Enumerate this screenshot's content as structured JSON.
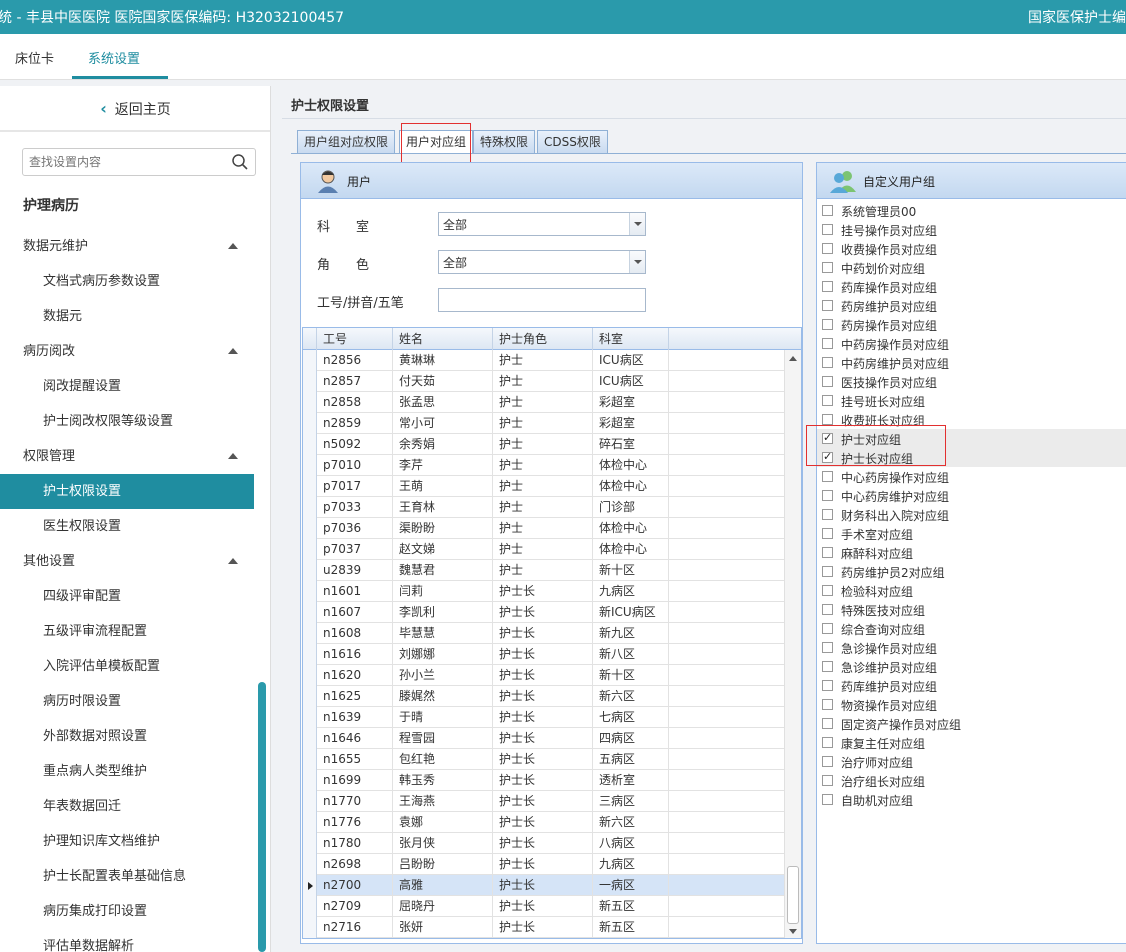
{
  "header": {
    "title": "统 - 丰县中医医院    医院国家医保编码: H32032100457",
    "right_text": "国家医保护士编码"
  },
  "topnav": {
    "tabs": [
      "床位卡",
      "系统设置"
    ]
  },
  "sidebar": {
    "back_label": "返回主页",
    "search_placeholder": "查找设置内容",
    "section_title": "护理病历",
    "items": [
      {
        "label": "数据元维护",
        "level": 1,
        "expand": true
      },
      {
        "label": "文档式病历参数设置",
        "level": 2
      },
      {
        "label": "数据元",
        "level": 2
      },
      {
        "label": "病历阅改",
        "level": 1,
        "expand": true
      },
      {
        "label": "阅改提醒设置",
        "level": 2
      },
      {
        "label": "护士阅改权限等级设置",
        "level": 2
      },
      {
        "label": "权限管理",
        "level": 1,
        "expand": true
      },
      {
        "label": "护士权限设置",
        "level": 2,
        "active": true
      },
      {
        "label": "医生权限设置",
        "level": 2
      },
      {
        "label": "其他设置",
        "level": 1,
        "expand": true
      },
      {
        "label": "四级评审配置",
        "level": 2
      },
      {
        "label": "五级评审流程配置",
        "level": 2
      },
      {
        "label": "入院评估单模板配置",
        "level": 2
      },
      {
        "label": "病历时限设置",
        "level": 2
      },
      {
        "label": "外部数据对照设置",
        "level": 2
      },
      {
        "label": "重点病人类型维护",
        "level": 2
      },
      {
        "label": "年表数据回迁",
        "level": 2
      },
      {
        "label": "护理知识库文档维护",
        "level": 2
      },
      {
        "label": "护士长配置表单基础信息",
        "level": 2
      },
      {
        "label": "病历集成打印设置",
        "level": 2
      },
      {
        "label": "评估单数据解析",
        "level": 2
      }
    ]
  },
  "main": {
    "title": "护士权限设置",
    "tabs": [
      "用户组对应权限",
      "用户对应组",
      "特殊权限",
      "CDSS权限"
    ],
    "active_tab": 1
  },
  "user_panel": {
    "title": "用户",
    "dept_label": "科　　室",
    "dept_value": "全部",
    "role_label": "角　　色",
    "role_value": "全部",
    "search_label": "工号/拼音/五笔",
    "search_value": ""
  },
  "grid": {
    "columns": [
      "工号",
      "姓名",
      "护士角色",
      "科室"
    ],
    "rows": [
      [
        "n2856",
        "黄琳琳",
        "护士",
        "ICU病区"
      ],
      [
        "n2857",
        "付天茹",
        "护士",
        "ICU病区"
      ],
      [
        "n2858",
        "张孟思",
        "护士",
        "彩超室"
      ],
      [
        "n2859",
        "常小可",
        "护士",
        "彩超室"
      ],
      [
        "n5092",
        "余秀娟",
        "护士",
        "碎石室"
      ],
      [
        "p7010",
        "李芹",
        "护士",
        "体检中心"
      ],
      [
        "p7017",
        "王萌",
        "护士",
        "体检中心"
      ],
      [
        "p7033",
        "王育林",
        "护士",
        "门诊部"
      ],
      [
        "p7036",
        "渠盼盼",
        "护士",
        "体检中心"
      ],
      [
        "p7037",
        "赵文娣",
        "护士",
        "体检中心"
      ],
      [
        "u2839",
        "魏慧君",
        "护士",
        "新十区"
      ],
      [
        "n1601",
        "闫莉",
        "护士长",
        "九病区"
      ],
      [
        "n1607",
        "李凯利",
        "护士长",
        "新ICU病区"
      ],
      [
        "n1608",
        "毕慧慧",
        "护士长",
        "新九区"
      ],
      [
        "n1616",
        "刘娜娜",
        "护士长",
        "新八区"
      ],
      [
        "n1620",
        "孙小兰",
        "护士长",
        "新十区"
      ],
      [
        "n1625",
        "滕娓然",
        "护士长",
        "新六区"
      ],
      [
        "n1639",
        "于晴",
        "护士长",
        "七病区"
      ],
      [
        "n1646",
        "程雪园",
        "护士长",
        "四病区"
      ],
      [
        "n1655",
        "包红艳",
        "护士长",
        "五病区"
      ],
      [
        "n1699",
        "韩玉秀",
        "护士长",
        "透析室"
      ],
      [
        "n1770",
        "王海燕",
        "护士长",
        "三病区"
      ],
      [
        "n1776",
        "袁娜",
        "护士长",
        "新六区"
      ],
      [
        "n1780",
        "张月侠",
        "护士长",
        "八病区"
      ],
      [
        "n2698",
        "吕盼盼",
        "护士长",
        "九病区"
      ],
      [
        "n2700",
        "高雅",
        "护士长",
        "一病区"
      ],
      [
        "n2709",
        "屈晓丹",
        "护士长",
        "新五区"
      ],
      [
        "n2716",
        "张妍",
        "护士长",
        "新五区"
      ]
    ],
    "selected_row": 25
  },
  "group_panel": {
    "title": "自定义用户组",
    "items": [
      {
        "label": "系统管理员00",
        "checked": false
      },
      {
        "label": "挂号操作员对应组",
        "checked": false
      },
      {
        "label": "收费操作员对应组",
        "checked": false
      },
      {
        "label": "中药划价对应组",
        "checked": false
      },
      {
        "label": "药库操作员对应组",
        "checked": false
      },
      {
        "label": "药房维护员对应组",
        "checked": false
      },
      {
        "label": "药房操作员对应组",
        "checked": false
      },
      {
        "label": "中药房操作员对应组",
        "checked": false
      },
      {
        "label": "中药房维护员对应组",
        "checked": false
      },
      {
        "label": "医技操作员对应组",
        "checked": false
      },
      {
        "label": "挂号班长对应组",
        "checked": false
      },
      {
        "label": "收费班长对应组",
        "checked": false
      },
      {
        "label": "护士对应组",
        "checked": true
      },
      {
        "label": "护士长对应组",
        "checked": true
      },
      {
        "label": "中心药房操作对应组",
        "checked": false
      },
      {
        "label": "中心药房维护对应组",
        "checked": false
      },
      {
        "label": "财务科出入院对应组",
        "checked": false
      },
      {
        "label": "手术室对应组",
        "checked": false
      },
      {
        "label": "麻醉科对应组",
        "checked": false
      },
      {
        "label": "药房维护员2对应组",
        "checked": false
      },
      {
        "label": "检验科对应组",
        "checked": false
      },
      {
        "label": "特殊医技对应组",
        "checked": false
      },
      {
        "label": "综合查询对应组",
        "checked": false
      },
      {
        "label": "急诊操作员对应组",
        "checked": false
      },
      {
        "label": "急诊维护员对应组",
        "checked": false
      },
      {
        "label": "药库维护员对应组",
        "checked": false
      },
      {
        "label": "物资操作员对应组",
        "checked": false
      },
      {
        "label": "固定资产操作员对应组",
        "checked": false
      },
      {
        "label": "康复主任对应组",
        "checked": false
      },
      {
        "label": "治疗师对应组",
        "checked": false
      },
      {
        "label": "治疗组长对应组",
        "checked": false
      },
      {
        "label": "自助机对应组",
        "checked": false
      }
    ]
  },
  "colors": {
    "accent": "#1f8da0",
    "header": "#2a9aab",
    "highlight_box": "#e23030"
  }
}
